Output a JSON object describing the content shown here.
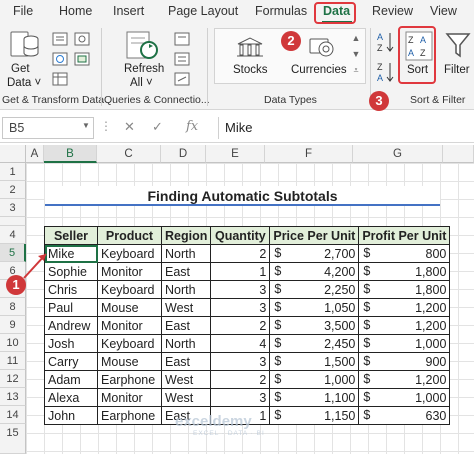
{
  "ribbon": {
    "tabs": [
      "File",
      "Home",
      "Insert",
      "Page Layout",
      "Formulas",
      "Data",
      "Review",
      "View"
    ],
    "active_tab": "Data",
    "groups": {
      "get_transform": {
        "get_data_label_1": "Get",
        "get_data_label_2": "Data ˅",
        "label": "Get & Transform Data"
      },
      "queries": {
        "refresh_label_1": "Refresh",
        "refresh_label_2": "All ˅",
        "label": "Queries & Connectio..."
      },
      "data_types": {
        "stocks_label": "Stocks",
        "currencies_label": "Currencies",
        "label": "Data Types"
      },
      "sort_filter": {
        "sort_label": "Sort",
        "filter_label": "Filter",
        "label": "Sort & Filter"
      }
    }
  },
  "formula_bar": {
    "name_box": "B5",
    "fx_label": "fx",
    "content": "Mike"
  },
  "columns": [
    "A",
    "B",
    "C",
    "D",
    "E",
    "F",
    "G"
  ],
  "rows": [
    "1",
    "2",
    "3",
    "4",
    "5",
    "6",
    "7",
    "8",
    "9",
    "10",
    "11",
    "12",
    "13",
    "14",
    "15"
  ],
  "sheet": {
    "title": "Finding Automatic Subtotals",
    "headers": [
      "Seller",
      "Product",
      "Region",
      "Quantity",
      "Price Per Unit",
      "Profit Per Unit"
    ],
    "currency_symbol": "$",
    "rows": [
      [
        "Mike",
        "Keyboard",
        "North",
        "2",
        "2,700",
        "800"
      ],
      [
        "Sophie",
        "Monitor",
        "East",
        "1",
        "4,200",
        "1,800"
      ],
      [
        "Chris",
        "Keyboard",
        "North",
        "3",
        "2,250",
        "1,800"
      ],
      [
        "Paul",
        "Mouse",
        "West",
        "3",
        "1,050",
        "1,200"
      ],
      [
        "Andrew",
        "Monitor",
        "East",
        "2",
        "3,500",
        "1,200"
      ],
      [
        "Josh",
        "Keyboard",
        "North",
        "4",
        "2,450",
        "1,000"
      ],
      [
        "Carry",
        "Mouse",
        "East",
        "3",
        "1,500",
        "900"
      ],
      [
        "Adam",
        "Earphone",
        "West",
        "2",
        "1,000",
        "1,200"
      ],
      [
        "Alexa",
        "Monitor",
        "West",
        "3",
        "1,100",
        "1,000"
      ],
      [
        "John",
        "Earphone",
        "East",
        "1",
        "1,150",
        "630"
      ]
    ]
  },
  "callouts": [
    "1",
    "2",
    "3"
  ],
  "watermark": {
    "name": "exceldemy",
    "tagline": "EXCEL · DATA · BI"
  },
  "colors": {
    "accent": "#1e7145",
    "header_fill": "#e2efda",
    "callout_red": "#e0383e"
  }
}
